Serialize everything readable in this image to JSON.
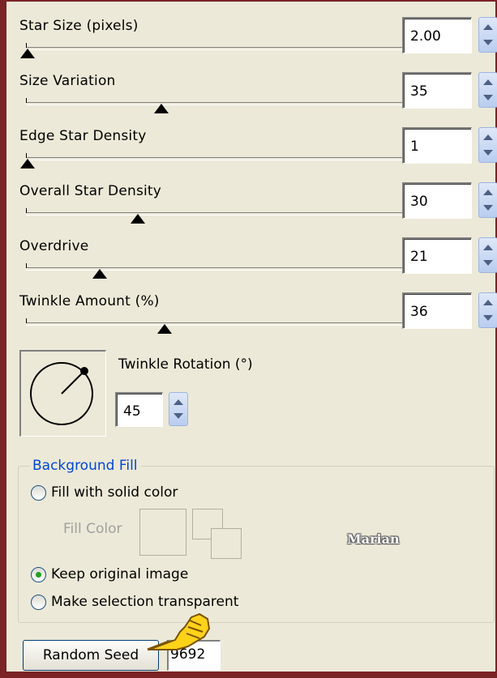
{
  "params": [
    {
      "label": "Star Size (pixels)",
      "value": "2.00",
      "fraction": 0.0
    },
    {
      "label": "Size Variation",
      "value": "35",
      "fraction": 0.35
    },
    {
      "label": "Edge Star Density",
      "value": "1",
      "fraction": 0.0
    },
    {
      "label": "Overall Star Density",
      "value": "30",
      "fraction": 0.29
    },
    {
      "label": "Overdrive",
      "value": "21",
      "fraction": 0.19
    },
    {
      "label": "Twinkle Amount (%)",
      "value": "36",
      "fraction": 0.36
    }
  ],
  "twinkle_rotation": {
    "label": "Twinkle Rotation (°)",
    "value": "45"
  },
  "background_fill": {
    "title": "Background Fill",
    "options": [
      {
        "label": "Fill with solid color",
        "checked": false
      },
      {
        "label": "Keep original image",
        "checked": true
      },
      {
        "label": "Make selection transparent",
        "checked": false
      }
    ],
    "fill_color_label": "Fill Color"
  },
  "watermark": "Marian",
  "random_seed": {
    "button_label": "Random Seed",
    "value": "9692"
  },
  "colors": {
    "accent": "#0046d5",
    "frame": "#7a2426",
    "background": "#ece9d8"
  }
}
